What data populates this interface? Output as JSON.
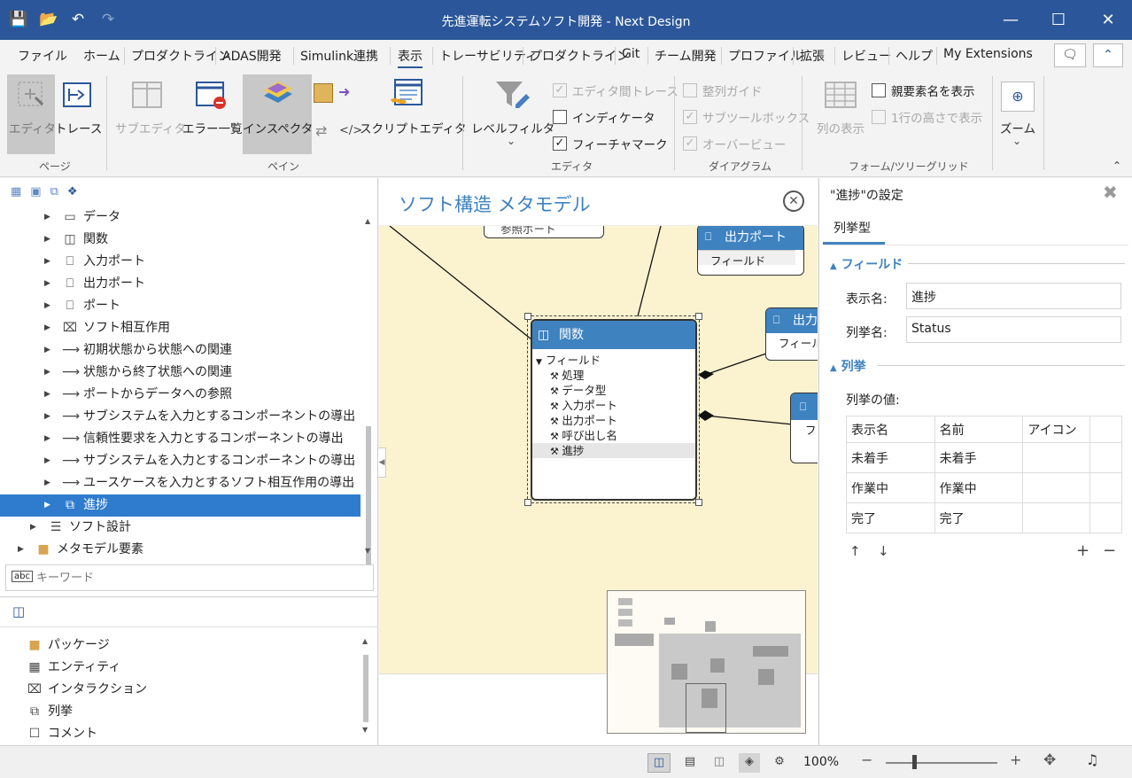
{
  "window": {
    "title": "先進運転システムソフト開発 - Next Design"
  },
  "menu": {
    "items": [
      "ファイル",
      "ホーム",
      "プロダクトライン",
      "ADAS開発",
      "Simulink連携",
      "表示",
      "トレーサビリティ",
      "プロダクトライン",
      "Git",
      "チーム開発",
      "プロファイル",
      "拡張",
      "レビュー",
      "ヘルプ",
      "My Extensions"
    ],
    "active": "表示"
  },
  "ribbon": {
    "editor": "エディタ",
    "trace": "トレース",
    "group_page": "ページ",
    "subeditor": "サブエディタ",
    "errors": "エラー一覧",
    "inspector": "インスペクタ",
    "script_editor": "スクリプトエディタ",
    "group_pane": "ペイン",
    "level_filter": "レベルフィルタ",
    "chk_editor_trace": "エディタ間トレース",
    "chk_indicator": "インディケータ",
    "chk_feature_mark": "フィーチャマーク",
    "group_editor": "エディタ",
    "chk_align_guide": "整列ガイド",
    "chk_subtoolbox": "サブツールボックス",
    "chk_overview": "オーバービュー",
    "group_diagram": "ダイアグラム",
    "col_display": "列の表示",
    "chk_parent_name": "親要素名を表示",
    "chk_one_row": "1行の高さで表示",
    "group_form": "フォーム/ツリーグリッド",
    "zoom": "ズーム"
  },
  "tree": {
    "items": [
      {
        "label": "データ",
        "icon": "data-icon"
      },
      {
        "label": "関数",
        "icon": "function-icon"
      },
      {
        "label": "入力ポート",
        "icon": "port-icon"
      },
      {
        "label": "出力ポート",
        "icon": "port-icon"
      },
      {
        "label": "ポート",
        "icon": "port-icon"
      },
      {
        "label": "ソフト相互作用",
        "icon": "interaction-icon"
      },
      {
        "label": "初期状態から状態への関連",
        "icon": "arrow-icon"
      },
      {
        "label": "状態から終了状態への関連",
        "icon": "arrow-icon"
      },
      {
        "label": "ポートからデータへの参照",
        "icon": "arrow-icon"
      },
      {
        "label": "サブシステムを入力とするコンポーネントの導出",
        "icon": "arrow-icon"
      },
      {
        "label": "信頼性要求を入力とするコンポーネントの導出",
        "icon": "arrow-icon"
      },
      {
        "label": "サブシステムを入力とするコンポーネントの導出",
        "icon": "arrow-icon"
      },
      {
        "label": "ユースケースを入力とするソフト相互作用の導出",
        "icon": "arrow-icon"
      },
      {
        "label": "進捗",
        "icon": "enum-icon"
      }
    ],
    "soft_design": "ソフト設計",
    "metamodel_elements": "メタモデル要素",
    "keyword_placeholder": "キーワード"
  },
  "toolbox": {
    "items": [
      "パッケージ",
      "エンティティ",
      "インタラクション",
      "列挙",
      "コメント"
    ]
  },
  "canvas": {
    "title": "ソフト構造 メタモデル",
    "class_name": "関数",
    "fields_header": "フィールド",
    "fields": [
      "処理",
      "データ型",
      "入力ポート",
      "出力ポート",
      "呼び出し名",
      "進捗"
    ],
    "ref_port": "参照ポート",
    "out_port": "出力ポート",
    "out_port_short": "出力",
    "field_label": "フィールド",
    "field_label_short": "フィール",
    "field_label_tiny": "フ"
  },
  "inspector": {
    "title": "\"進捗\"の設定",
    "tab": "列挙型",
    "section_fields": "フィールド",
    "display_name_label": "表示名:",
    "display_name_value": "進捗",
    "enum_name_label": "列挙名:",
    "enum_name_value": "Status",
    "section_enum": "列挙",
    "enum_values_label": "列挙の値:",
    "columns": [
      "表示名",
      "名前",
      "アイコン"
    ],
    "rows": [
      [
        "未着手",
        "未着手"
      ],
      [
        "作業中",
        "作業中"
      ],
      [
        "完了",
        "完了"
      ]
    ]
  },
  "status": {
    "zoom": "100%"
  }
}
